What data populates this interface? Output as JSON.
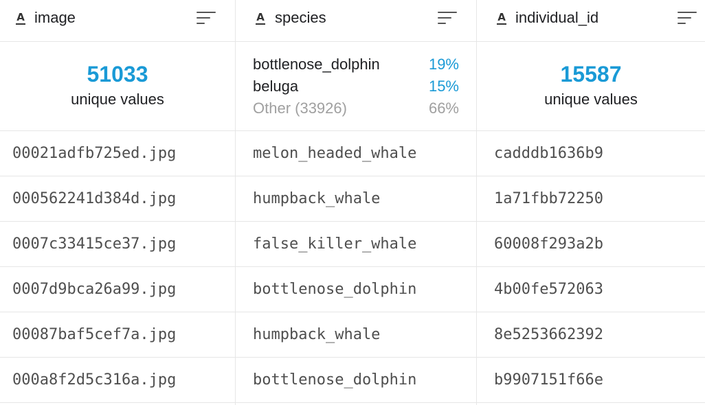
{
  "columns": [
    {
      "name": "image",
      "type_icon": "string-type-icon",
      "summary": {
        "kind": "unique",
        "count": "51033",
        "label": "unique values"
      },
      "values": [
        "00021adfb725ed.jpg",
        "000562241d384d.jpg",
        "0007c33415ce37.jpg",
        "0007d9bca26a99.jpg",
        "00087baf5cef7a.jpg",
        "000a8f2d5c316a.jpg"
      ]
    },
    {
      "name": "species",
      "type_icon": "string-type-icon",
      "summary": {
        "kind": "top_values",
        "items": [
          {
            "label": "bottlenose_dolphin",
            "percent": "19%"
          },
          {
            "label": "beluga",
            "percent": "15%"
          },
          {
            "label": "Other (33926)",
            "percent": "66%"
          }
        ]
      },
      "values": [
        "melon_headed_whale",
        "humpback_whale",
        "false_killer_whale",
        "bottlenose_dolphin",
        "humpback_whale",
        "bottlenose_dolphin"
      ]
    },
    {
      "name": "individual_id",
      "type_icon": "string-type-icon",
      "summary": {
        "kind": "unique",
        "count": "15587",
        "label": "unique values"
      },
      "values": [
        "cadddb1636b9",
        "1a71fbb72250",
        "60008f293a2b",
        "4b00fe572063",
        "8e5253662392",
        "b9907151f66e"
      ]
    }
  ],
  "type_icon_glyph": "A",
  "colors": {
    "accent": "#1a9ad6",
    "muted": "#a0a0a0",
    "cell_text": "#4f4f4f",
    "border": "#e6e6e6"
  }
}
